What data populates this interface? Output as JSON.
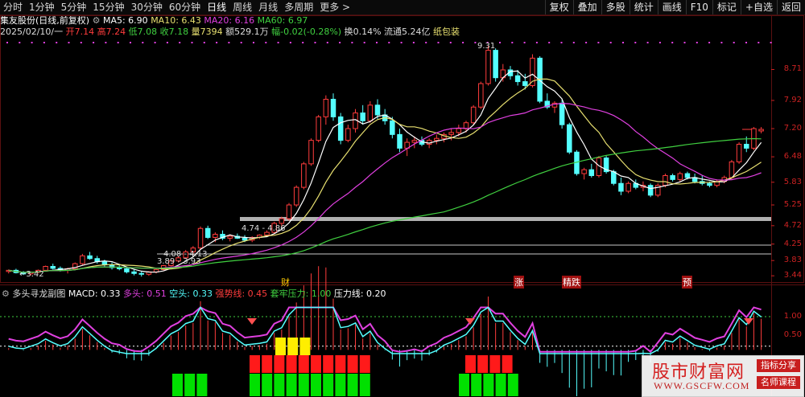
{
  "topbar": {
    "left_tabs": [
      "分时",
      "1分钟",
      "5分钟",
      "15分钟",
      "30分钟",
      "60分钟",
      "日线",
      "周线",
      "月线",
      "多周期",
      "更多 >"
    ],
    "active_tab": "日线",
    "right_buttons": [
      "复权",
      "叠加",
      "多股",
      "统计",
      "画线",
      "F10",
      "标记",
      "+自选",
      "返回"
    ]
  },
  "quote": {
    "stock_name": "集友股份(日线,前复权)",
    "ma5": "MA5: 6.90",
    "ma10": "MA10: 6.43",
    "ma20": "MA20: 6.16",
    "ma60": "MA60: 6.97",
    "line2": {
      "date": "2025/02/10/一",
      "open": "开7.14",
      "high": "高7.24",
      "low": "低7.08",
      "close": "收7.18",
      "volume": "量7394",
      "amount": "额529.1万",
      "change": "幅-0.02(-0.28%)",
      "turnover": "换0.14%",
      "float_cap": "流通5.24亿",
      "concept": "纸包装"
    }
  },
  "price_axis": [
    "8.71",
    "7.92",
    "7.20",
    "6.48",
    "5.83",
    "5.25",
    "4.72",
    "4.25",
    "3.83",
    "3.44"
  ],
  "annotations": {
    "high_label": "9.31",
    "low_label": "←3.42",
    "range_a": "4.74 - 4.86",
    "range_b": "4.08 - 4.13",
    "range_c": "3.89 - 3.93",
    "events": [
      "财",
      "涨",
      "精跌",
      "预"
    ]
  },
  "indicator": {
    "title": "多头寻龙副图",
    "macd": "MACD: 0.33",
    "bull": "多头: 0.51",
    "bear": "空头: 0.33",
    "strong": "强势线: 0.45",
    "resist": "套牢压力: 1.00",
    "pressure": "压力线: 0.20",
    "axis": [
      "1.00",
      "0.50"
    ]
  },
  "watermark": {
    "title": "股市财富网",
    "url": "WWW.GSCFW.COM",
    "tag1": "指标分享",
    "tag2": "名师课程"
  },
  "colors": {
    "up": "#ff3c3c",
    "down": "#54ffff",
    "ma5": "#ffffff",
    "ma10": "#e8e070",
    "ma20": "#e040e0",
    "ma60": "#40d040",
    "axis": "#cc2222"
  },
  "chart_data": {
    "type": "candlestick",
    "price_range": [
      3.3,
      9.5
    ],
    "candles": [
      [
        3.55,
        3.6,
        3.5,
        3.58
      ],
      [
        3.58,
        3.62,
        3.5,
        3.52
      ],
      [
        3.52,
        3.56,
        3.46,
        3.49
      ],
      [
        3.49,
        3.55,
        3.45,
        3.53
      ],
      [
        3.53,
        3.6,
        3.5,
        3.58
      ],
      [
        3.58,
        3.7,
        3.55,
        3.68
      ],
      [
        3.68,
        3.75,
        3.6,
        3.63
      ],
      [
        3.63,
        3.68,
        3.55,
        3.58
      ],
      [
        3.58,
        3.65,
        3.5,
        3.62
      ],
      [
        3.62,
        3.78,
        3.6,
        3.75
      ],
      [
        3.75,
        4.0,
        3.72,
        3.95
      ],
      [
        3.95,
        4.05,
        3.85,
        3.88
      ],
      [
        3.88,
        3.95,
        3.75,
        3.8
      ],
      [
        3.8,
        3.85,
        3.68,
        3.72
      ],
      [
        3.72,
        3.78,
        3.6,
        3.65
      ],
      [
        3.65,
        3.72,
        3.58,
        3.62
      ],
      [
        3.62,
        3.66,
        3.5,
        3.54
      ],
      [
        3.54,
        3.6,
        3.45,
        3.5
      ],
      [
        3.5,
        3.55,
        3.42,
        3.48
      ],
      [
        3.48,
        3.56,
        3.44,
        3.54
      ],
      [
        3.54,
        3.62,
        3.5,
        3.6
      ],
      [
        3.6,
        3.72,
        3.58,
        3.7
      ],
      [
        3.7,
        3.85,
        3.68,
        3.82
      ],
      [
        3.82,
        3.95,
        3.78,
        3.9
      ],
      [
        3.9,
        4.1,
        3.88,
        4.05
      ],
      [
        4.05,
        4.2,
        3.98,
        4.15
      ],
      [
        4.15,
        4.7,
        4.12,
        4.65
      ],
      [
        4.65,
        4.72,
        4.38,
        4.42
      ],
      [
        4.42,
        4.55,
        4.3,
        4.5
      ],
      [
        4.5,
        4.6,
        4.35,
        4.4
      ],
      [
        4.4,
        4.5,
        4.32,
        4.45
      ],
      [
        4.45,
        4.52,
        4.38,
        4.4
      ],
      [
        4.4,
        4.48,
        4.3,
        4.35
      ],
      [
        4.35,
        4.45,
        4.3,
        4.42
      ],
      [
        4.42,
        4.5,
        4.38,
        4.48
      ],
      [
        4.48,
        4.6,
        4.44,
        4.55
      ],
      [
        4.55,
        4.82,
        4.5,
        4.78
      ],
      [
        4.78,
        4.95,
        4.7,
        4.9
      ],
      [
        4.9,
        5.3,
        4.85,
        5.25
      ],
      [
        5.25,
        5.75,
        5.2,
        5.7
      ],
      [
        5.7,
        6.35,
        5.65,
        6.3
      ],
      [
        6.3,
        6.95,
        6.25,
        6.9
      ],
      [
        6.9,
        7.55,
        6.85,
        7.5
      ],
      [
        7.5,
        8.05,
        7.3,
        7.95
      ],
      [
        7.95,
        8.1,
        7.4,
        7.5
      ],
      [
        7.5,
        7.6,
        6.8,
        6.9
      ],
      [
        6.9,
        7.3,
        6.85,
        7.2
      ],
      [
        7.2,
        7.7,
        7.1,
        7.6
      ],
      [
        7.6,
        7.8,
        7.3,
        7.4
      ],
      [
        7.4,
        7.9,
        7.35,
        7.8
      ],
      [
        7.8,
        7.95,
        7.45,
        7.55
      ],
      [
        7.55,
        7.7,
        7.3,
        7.4
      ],
      [
        7.4,
        7.5,
        6.95,
        7.05
      ],
      [
        7.05,
        7.2,
        6.6,
        6.7
      ],
      [
        6.7,
        6.95,
        6.5,
        6.85
      ],
      [
        6.85,
        7.0,
        6.7,
        6.9
      ],
      [
        6.9,
        7.0,
        6.75,
        6.8
      ],
      [
        6.8,
        6.95,
        6.7,
        6.9
      ],
      [
        6.9,
        7.05,
        6.8,
        6.95
      ],
      [
        6.95,
        7.1,
        6.85,
        7.05
      ],
      [
        7.05,
        7.2,
        6.9,
        7.1
      ],
      [
        7.1,
        7.3,
        7.0,
        7.2
      ],
      [
        7.2,
        7.4,
        7.1,
        7.35
      ],
      [
        7.35,
        7.8,
        7.3,
        7.75
      ],
      [
        7.75,
        8.4,
        7.7,
        8.35
      ],
      [
        8.35,
        9.31,
        8.3,
        9.2
      ],
      [
        9.2,
        9.25,
        8.4,
        8.5
      ],
      [
        8.5,
        8.85,
        8.4,
        8.7
      ],
      [
        8.7,
        8.8,
        8.45,
        8.55
      ],
      [
        8.55,
        8.7,
        8.3,
        8.4
      ],
      [
        8.4,
        8.6,
        8.2,
        8.3
      ],
      [
        8.3,
        9.1,
        8.25,
        9.0
      ],
      [
        9.0,
        9.05,
        7.85,
        7.9
      ],
      [
        7.9,
        8.1,
        7.7,
        7.75
      ],
      [
        7.75,
        7.9,
        7.6,
        7.85
      ],
      [
        7.85,
        7.95,
        7.2,
        7.3
      ],
      [
        7.3,
        7.35,
        6.55,
        6.6
      ],
      [
        6.6,
        6.65,
        6.0,
        6.05
      ],
      [
        6.05,
        6.2,
        5.9,
        6.15
      ],
      [
        6.15,
        6.3,
        5.95,
        6.0
      ],
      [
        6.0,
        6.5,
        5.95,
        6.45
      ],
      [
        6.45,
        6.5,
        6.05,
        6.1
      ],
      [
        6.1,
        6.15,
        5.75,
        5.8
      ],
      [
        5.8,
        5.95,
        5.5,
        5.6
      ],
      [
        5.6,
        5.85,
        5.55,
        5.8
      ],
      [
        5.8,
        5.9,
        5.65,
        5.7
      ],
      [
        5.7,
        5.85,
        5.6,
        5.75
      ],
      [
        5.75,
        5.8,
        5.45,
        5.5
      ],
      [
        5.5,
        5.8,
        5.45,
        5.75
      ],
      [
        5.75,
        6.05,
        5.7,
        6.0
      ],
      [
        6.0,
        6.05,
        5.85,
        5.9
      ],
      [
        5.9,
        6.1,
        5.85,
        6.05
      ],
      [
        6.05,
        6.1,
        5.9,
        5.95
      ],
      [
        5.95,
        6.05,
        5.8,
        5.85
      ],
      [
        5.85,
        6.0,
        5.75,
        5.8
      ],
      [
        5.8,
        5.85,
        5.7,
        5.75
      ],
      [
        5.75,
        5.9,
        5.7,
        5.85
      ],
      [
        5.85,
        6.0,
        5.8,
        5.95
      ],
      [
        5.95,
        6.4,
        5.9,
        6.35
      ],
      [
        6.35,
        6.85,
        6.3,
        6.8
      ],
      [
        6.8,
        7.0,
        6.6,
        6.7
      ],
      [
        6.7,
        7.24,
        6.65,
        7.2
      ],
      [
        7.14,
        7.24,
        7.08,
        7.18
      ]
    ]
  }
}
